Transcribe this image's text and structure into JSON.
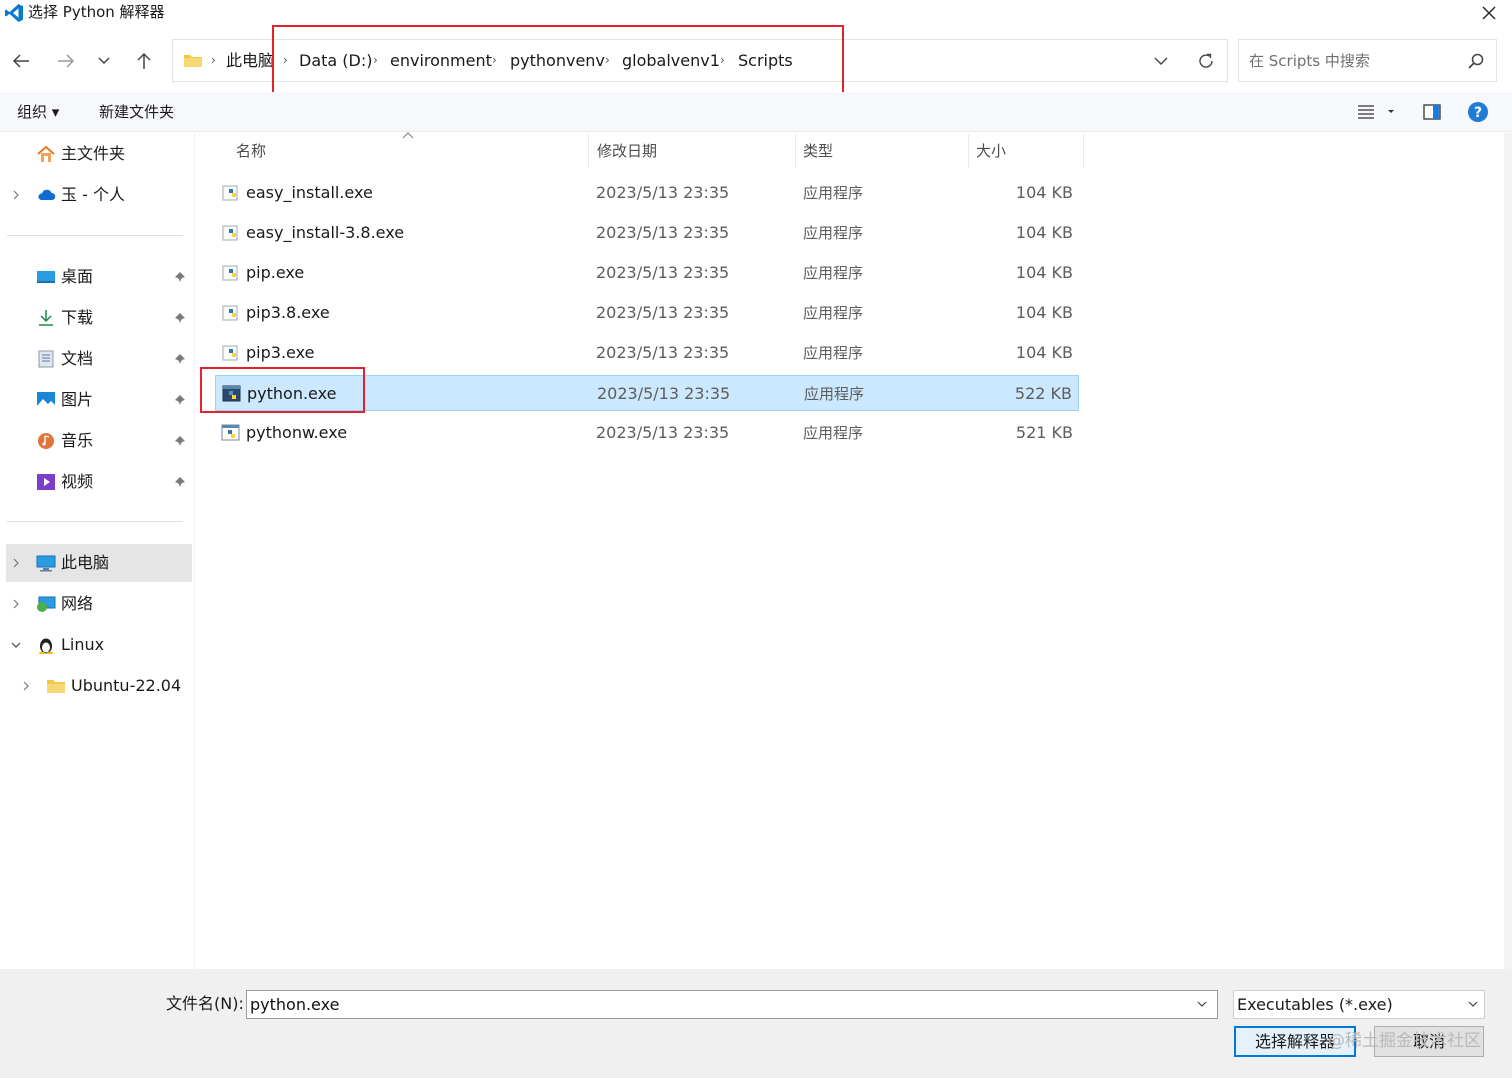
{
  "window": {
    "title": "选择 Python 解释器"
  },
  "nav": {
    "back": "back-arrow-icon",
    "forward": "forward-arrow-icon",
    "recent": "chevron-down-icon",
    "up": "up-arrow-icon"
  },
  "address": {
    "crumbs": [
      "此电脑",
      "Data (D:)",
      "environment",
      "pythonvenv",
      "globalvenv1",
      "Scripts"
    ]
  },
  "search": {
    "placeholder": "在 Scripts 中搜索"
  },
  "toolbar": {
    "organize": "组织 ▾",
    "new_folder": "新建文件夹"
  },
  "sidebar": {
    "home": "主文件夹",
    "onedrive": "玉 - 个人",
    "quick": [
      {
        "label": "桌面"
      },
      {
        "label": "下载"
      },
      {
        "label": "文档"
      },
      {
        "label": "图片"
      },
      {
        "label": "音乐"
      },
      {
        "label": "视频"
      }
    ],
    "this_pc": "此电脑",
    "network": "网络",
    "linux": "Linux",
    "ubuntu": "Ubuntu-22.04"
  },
  "columns": {
    "name": "名称",
    "date": "修改日期",
    "type": "类型",
    "size": "大小"
  },
  "files": [
    {
      "name": "easy_install.exe",
      "date": "2023/5/13 23:35",
      "type": "应用程序",
      "size": "104 KB"
    },
    {
      "name": "easy_install-3.8.exe",
      "date": "2023/5/13 23:35",
      "type": "应用程序",
      "size": "104 KB"
    },
    {
      "name": "pip.exe",
      "date": "2023/5/13 23:35",
      "type": "应用程序",
      "size": "104 KB"
    },
    {
      "name": "pip3.8.exe",
      "date": "2023/5/13 23:35",
      "type": "应用程序",
      "size": "104 KB"
    },
    {
      "name": "pip3.exe",
      "date": "2023/5/13 23:35",
      "type": "应用程序",
      "size": "104 KB"
    },
    {
      "name": "python.exe",
      "date": "2023/5/13 23:35",
      "type": "应用程序",
      "size": "522 KB",
      "selected": true
    },
    {
      "name": "pythonw.exe",
      "date": "2023/5/13 23:35",
      "type": "应用程序",
      "size": "521 KB"
    }
  ],
  "footer": {
    "filename_label": "文件名(N):",
    "filename_value": "python.exe",
    "filetype": "Executables (*.exe)",
    "ok": "选择解释器",
    "cancel": "取消"
  },
  "watermark": "@稀土掘金技术社区",
  "colors": {
    "accent": "#0078d7",
    "highlight": "#e0232d",
    "selection": "#cce8ff"
  }
}
